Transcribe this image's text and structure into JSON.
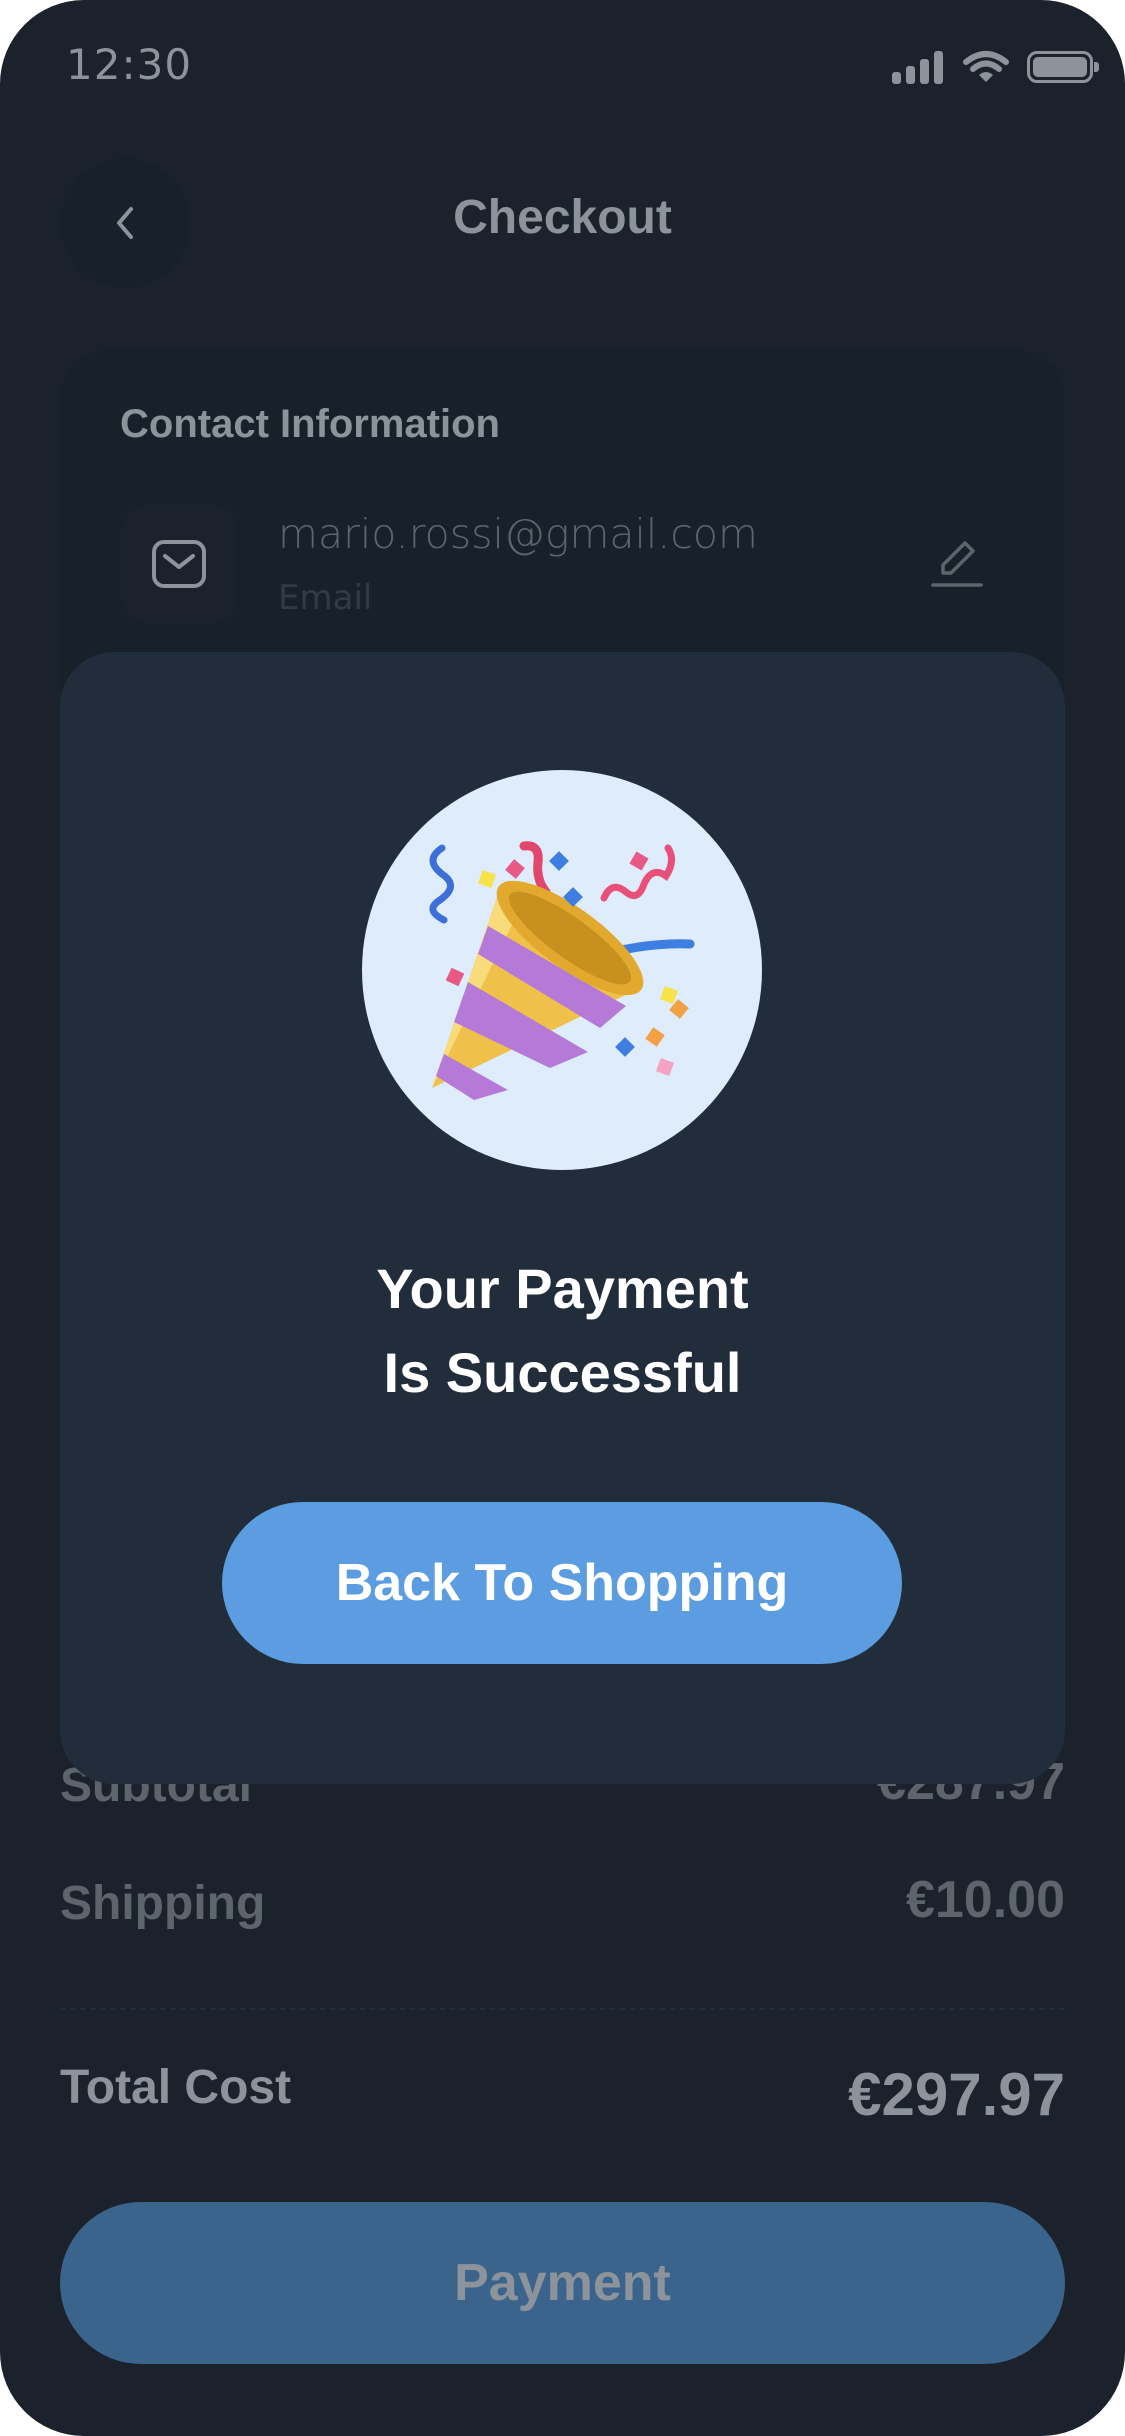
{
  "status_bar": {
    "time": "12:30"
  },
  "header": {
    "title": "Checkout"
  },
  "contact": {
    "heading": "Contact Information",
    "email_value": "mario.rossi@gmail.com",
    "email_label": "Email"
  },
  "summary": {
    "subtotal_label": "Subtotal",
    "subtotal_value": "€287.97",
    "shipping_label": "Shipping",
    "shipping_value": "€10.00",
    "total_label": "Total Cost",
    "total_value": "€297.97",
    "payment_label": "Payment"
  },
  "modal": {
    "title_line1": "Your Payment",
    "title_line2": "Is Successful",
    "button_label": "Back To Shopping",
    "icon": "party-popper-icon"
  },
  "colors": {
    "background": "#1b222c",
    "modal": "#212d3b",
    "accent": "#5b9de0",
    "payment_button": "#3a648c"
  }
}
